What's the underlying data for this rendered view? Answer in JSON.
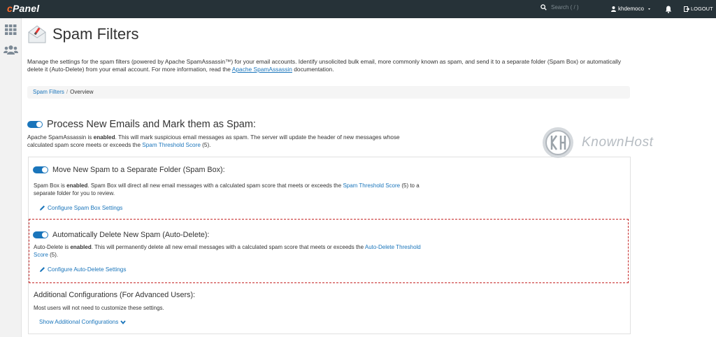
{
  "topbar": {
    "logo": "cPanel",
    "search_placeholder": "Search ( / )",
    "username": "khdemoco",
    "logout_label": "LOGOUT",
    "bg": "#263238"
  },
  "sidebar": {
    "icons": [
      "grid-icon",
      "users-icon"
    ]
  },
  "page": {
    "title": "Spam Filters",
    "description_1": "Manage the settings for the spam filters (powered by Apache SpamAssassin™) for your email accounts. Identify unsolicited bulk email, more commonly known as spam, and send it to a separate folder (Spam Box) or automatically delete it (Auto-Delete) from your email account. For more information, read the ",
    "description_link": "Apache SpamAssassin",
    "description_2": " documentation."
  },
  "breadcrumb": {
    "items": [
      "Spam Filters",
      "Overview"
    ]
  },
  "process_section": {
    "title": "Process New Emails and Mark them as Spam:",
    "text_1": "Apache SpamAssassin is ",
    "text_bold": "enabled",
    "text_2": ". This will mark suspicious email messages as spam. The server will update the header of new messages whose calculated spam score meets or exceeds the ",
    "text_link": "Spam Threshold Score",
    "text_3": " (5)."
  },
  "spam_box": {
    "title": "Move New Spam to a Separate Folder (Spam Box):",
    "text_1": "Spam Box is ",
    "text_bold": "enabled",
    "text_2": ". Spam Box will direct all new email messages with a calculated spam score that meets or exceeds the ",
    "text_link": "Spam Threshold Score",
    "text_3": " (5) to a separate folder for you to review.",
    "configure_label": "Configure Spam Box Settings"
  },
  "auto_delete": {
    "title": "Automatically Delete New Spam (Auto-Delete):",
    "text_1": "Auto-Delete is ",
    "text_bold": "enabled",
    "text_2": ". This will permanently delete all new email messages with a calculated spam score that meets or exceeds the ",
    "text_link": "Auto-Delete Threshold Score",
    "text_3": " (5).",
    "configure_label": "Configure Auto-Delete Settings"
  },
  "additional": {
    "title": "Additional Configurations (For Advanced Users):",
    "text": "Most users will not need to customize these settings.",
    "show_label": "Show Additional Configurations"
  },
  "watermark": {
    "text": "KnownHost"
  },
  "colors": {
    "accent": "#1a75bb",
    "highlight_border": "#c62828",
    "cpanel_orange": "#ff6c2c"
  }
}
